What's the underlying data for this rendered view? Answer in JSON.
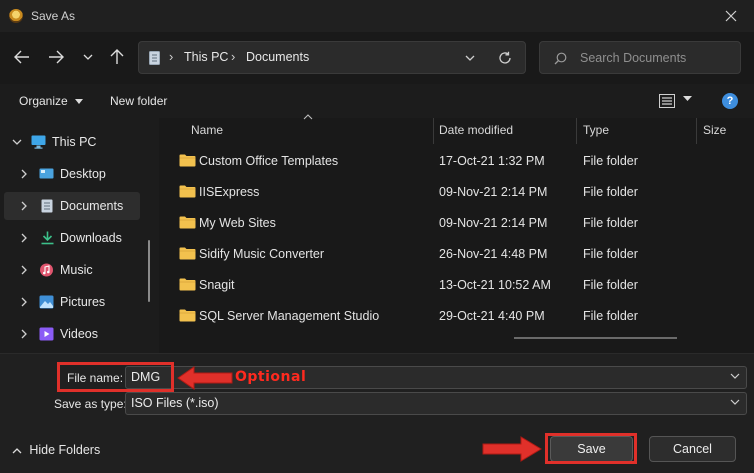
{
  "window": {
    "title": "Save As"
  },
  "nav": {
    "breadcrumb": [
      "This PC",
      "Documents"
    ],
    "search_placeholder": "Search Documents"
  },
  "commands": {
    "organize": "Organize",
    "new_folder": "New folder"
  },
  "sidebar": {
    "items": [
      {
        "label": "This PC",
        "icon": "monitor-icon"
      },
      {
        "label": "Desktop",
        "icon": "desktop-icon"
      },
      {
        "label": "Documents",
        "icon": "documents-icon",
        "selected": true
      },
      {
        "label": "Downloads",
        "icon": "download-icon"
      },
      {
        "label": "Music",
        "icon": "music-icon"
      },
      {
        "label": "Pictures",
        "icon": "pictures-icon"
      },
      {
        "label": "Videos",
        "icon": "videos-icon"
      }
    ]
  },
  "files": {
    "columns": [
      "Name",
      "Date modified",
      "Type",
      "Size"
    ],
    "rows": [
      {
        "name": "Custom Office Templates",
        "date": "17-Oct-21 1:32 PM",
        "type": "File folder"
      },
      {
        "name": "IISExpress",
        "date": "09-Nov-21 2:14 PM",
        "type": "File folder"
      },
      {
        "name": "My Web Sites",
        "date": "09-Nov-21 2:14 PM",
        "type": "File folder"
      },
      {
        "name": "Sidify Music Converter",
        "date": "26-Nov-21 4:48 PM",
        "type": "File folder"
      },
      {
        "name": "Snagit",
        "date": "13-Oct-21 10:52 AM",
        "type": "File folder"
      },
      {
        "name": "SQL Server Management Studio",
        "date": "29-Oct-21 4:40 PM",
        "type": "File folder"
      }
    ]
  },
  "form": {
    "file_name_label": "File name:",
    "file_name_value": "DMG",
    "save_type_label": "Save as type:",
    "save_type_value": "ISO Files (*.iso)",
    "annotation": "Optional"
  },
  "buttons": {
    "hide_folders": "Hide Folders",
    "save": "Save",
    "cancel": "Cancel"
  },
  "colors": {
    "annotation_red": "#e0302a",
    "folder_yellow": "#f2c14e",
    "accent_blue": "#3e8ede"
  }
}
